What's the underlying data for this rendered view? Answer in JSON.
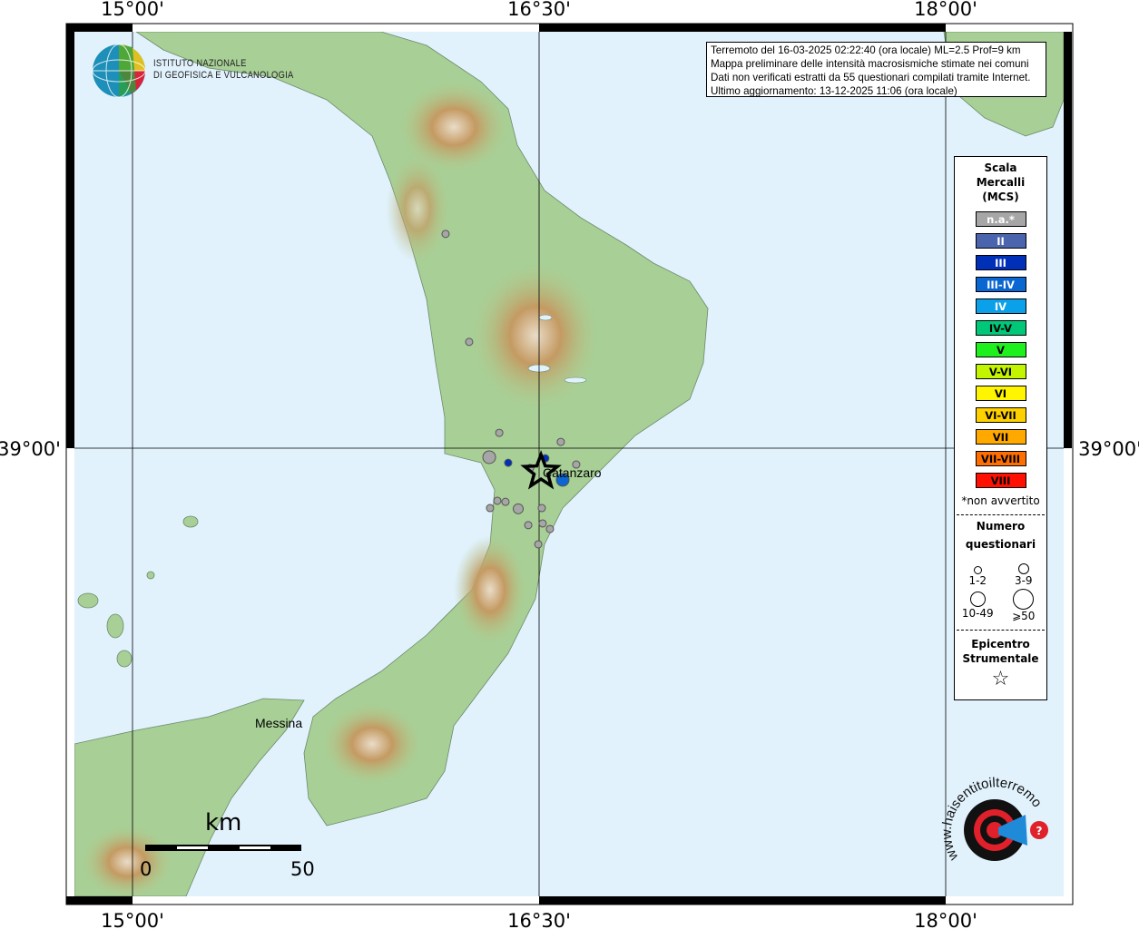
{
  "map": {
    "lon_ticks": [
      "15°00'",
      "16°30'",
      "18°00'"
    ],
    "lat_ticks": [
      "39°00'"
    ],
    "places": [
      {
        "name": "Catanzaro",
        "lon": 16.52,
        "lat": 38.935
      },
      {
        "name": "Messina",
        "lon": 15.45,
        "lat": 38.2
      }
    ],
    "scale_bar": {
      "unit": "km",
      "labels": [
        "0",
        "50"
      ]
    },
    "epicenter": {
      "lon": 16.507,
      "lat": 38.932
    },
    "points": [
      {
        "lon": 16.155,
        "lat": 39.615,
        "intensity": "n.a.*",
        "responses": "1-2"
      },
      {
        "lon": 16.242,
        "lat": 39.305,
        "intensity": "n.a.*",
        "responses": "1-2"
      },
      {
        "lon": 16.353,
        "lat": 39.044,
        "intensity": "n.a.*",
        "responses": "1-2"
      },
      {
        "lon": 16.58,
        "lat": 39.018,
        "intensity": "n.a.*",
        "responses": "1-2"
      },
      {
        "lon": 16.316,
        "lat": 38.974,
        "intensity": "n.a.*",
        "responses": "10-49"
      },
      {
        "lon": 16.386,
        "lat": 38.958,
        "intensity": "III",
        "responses": "1-2"
      },
      {
        "lon": 16.523,
        "lat": 38.971,
        "intensity": "III",
        "responses": "1-2"
      },
      {
        "lon": 16.637,
        "lat": 38.953,
        "intensity": "n.a.*",
        "responses": "1-2"
      },
      {
        "lon": 16.467,
        "lat": 38.943,
        "intensity": "n.a.*",
        "responses": "1-2"
      },
      {
        "lon": 16.587,
        "lat": 38.909,
        "intensity": "III-IV",
        "responses": "10-49"
      },
      {
        "lon": 16.346,
        "lat": 38.849,
        "intensity": "n.a.*",
        "responses": "1-2"
      },
      {
        "lon": 16.376,
        "lat": 38.846,
        "intensity": "n.a.*",
        "responses": "1-2"
      },
      {
        "lon": 16.319,
        "lat": 38.828,
        "intensity": "n.a.*",
        "responses": "1-2"
      },
      {
        "lon": 16.423,
        "lat": 38.826,
        "intensity": "n.a.*",
        "responses": "3-9"
      },
      {
        "lon": 16.51,
        "lat": 38.828,
        "intensity": "n.a.*",
        "responses": "1-2"
      },
      {
        "lon": 16.513,
        "lat": 38.784,
        "intensity": "n.a.*",
        "responses": "1-2"
      },
      {
        "lon": 16.46,
        "lat": 38.779,
        "intensity": "n.a.*",
        "responses": "1-2"
      },
      {
        "lon": 16.54,
        "lat": 38.768,
        "intensity": "n.a.*",
        "responses": "1-2"
      },
      {
        "lon": 16.497,
        "lat": 38.724,
        "intensity": "n.a.*",
        "responses": "1-2"
      }
    ]
  },
  "info_box": {
    "line1": "Terremoto del 16-03-2025 02:22:40 (ora locale) ML=2.5 Prof=9 km",
    "line2": "Mappa preliminare delle intensità macrosismiche stimate nei comuni",
    "line3": "Dati non verificati estratti da 55 questionari compilati tramite Internet.",
    "line4": "Ultimo aggiornamento: 13-12-2025 11:06 (ora locale)"
  },
  "institute_logo": {
    "line1": "ISTITUTO NAZIONALE",
    "line2": "DI GEOFISICA E VULCANOLOGIA"
  },
  "site_logo": {
    "text": "www.haisentitoilterremoto.it",
    "icon": "target-megaphone-icon"
  },
  "legend": {
    "title1": "Scala",
    "title2": "Mercalli",
    "title3": "(MCS)",
    "classes": [
      {
        "label": "n.a.*",
        "color": "#a6a6a6",
        "text_color": "#ffffff"
      },
      {
        "label": "II",
        "color": "#4a64ad",
        "text_color": "#ffffff"
      },
      {
        "label": "III",
        "color": "#0030b8",
        "text_color": "#ffffff"
      },
      {
        "label": "III-IV",
        "color": "#0a66d0",
        "text_color": "#ffffff"
      },
      {
        "label": "IV",
        "color": "#0aa0ea",
        "text_color": "#ffffff"
      },
      {
        "label": "IV-V",
        "color": "#00c878",
        "text_color": "#000000"
      },
      {
        "label": "V",
        "color": "#1ef01e",
        "text_color": "#000000"
      },
      {
        "label": "V-VI",
        "color": "#c3f500",
        "text_color": "#000000"
      },
      {
        "label": "VI",
        "color": "#fff500",
        "text_color": "#000000"
      },
      {
        "label": "VI-VII",
        "color": "#ffd000",
        "text_color": "#000000"
      },
      {
        "label": "VII",
        "color": "#ffa800",
        "text_color": "#000000"
      },
      {
        "label": "VII-VIII",
        "color": "#ff6e00",
        "text_color": "#000000"
      },
      {
        "label": "VIII",
        "color": "#ff1000",
        "text_color": "#000000"
      }
    ],
    "note": "*non avvertito",
    "size_title1": "Numero",
    "size_title2": "questionari",
    "sizes": [
      "1-2",
      "3-9",
      "10-49",
      "⩾50"
    ],
    "epi_title1": "Epicentro",
    "epi_title2": "Strumentale",
    "epi_symbol": "☆"
  }
}
